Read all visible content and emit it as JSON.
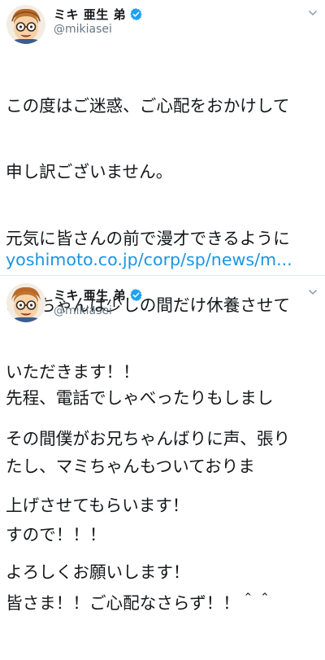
{
  "tweets": [
    {
      "display_name": "ミキ 亜生 弟",
      "handle": "@mikiasei",
      "avatar_icon": "avatar-caricature-glasses",
      "verified_icon": "verified-badge-icon",
      "lines": [
        "この度はご迷惑、ご心配をおかけして",
        "申し訳ございません。",
        "元気に皆さんの前で漫才できるように",
        "お兄ちゃんは少しの間だけ休養させて",
        "いただきます！！",
        "その間僕がお兄ちゃんばりに声、張り",
        "上げさせてもらいます！",
        "よろしくお願いします！"
      ],
      "link": "yoshimoto.co.jp/corp/sp/news/m..."
    },
    {
      "display_name": "ミキ 亜生 弟",
      "handle": "@mikiasei",
      "avatar_icon": "avatar-caricature-glasses",
      "verified_icon": "verified-badge-icon",
      "lines": [
        "先程、電話でしゃべったりもしまし",
        "たし、マミちゃんもついておりま",
        "すので！！！",
        "皆さま！！ご心配なさらず！！＾＾"
      ]
    }
  ],
  "colors": {
    "verified": "#1da1f2",
    "link": "#1b95e0",
    "handle": "#657786",
    "text": "#14171a"
  }
}
